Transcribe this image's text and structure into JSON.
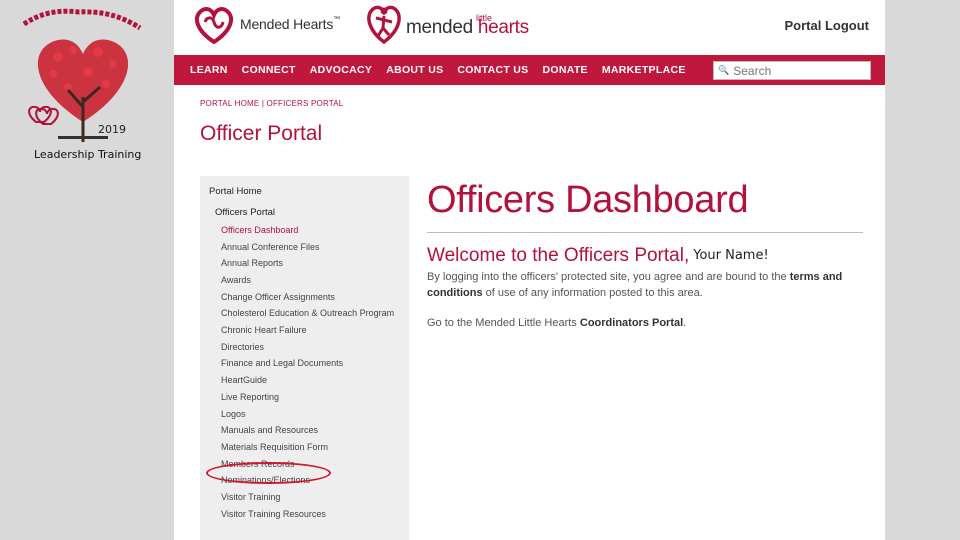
{
  "slide": {
    "year": "2019",
    "training_label": "Leadership Training"
  },
  "header": {
    "brand1": "Mended Hearts",
    "brand1_tm": "™",
    "brand2_small": "little",
    "brand2_a": "mended ",
    "brand2_b": "hearts",
    "logout": "Portal Logout"
  },
  "nav": {
    "items": [
      "LEARN",
      "CONNECT",
      "ADVOCACY",
      "ABOUT US",
      "CONTACT US",
      "DONATE",
      "MARKETPLACE"
    ],
    "search_placeholder": "Search"
  },
  "breadcrumb": "PORTAL HOME | OFFICERS PORTAL",
  "page_title": "Officer Portal",
  "sidebar": {
    "home": "Portal Home",
    "section": "Officers Portal",
    "items": [
      "Officers Dashboard",
      "Annual Conference Files",
      "Annual Reports",
      "Awards",
      "Change Officer Assignments",
      "Cholesterol Education & Outreach Program",
      "Chronic Heart Failure",
      "Directories",
      "Finance and Legal Documents",
      "HeartGuide",
      "Live Reporting",
      "Logos",
      "Manuals and Resources",
      "Materials Requisition Form",
      "Members Records",
      "Nominations/Elections",
      "Visitor Training",
      "Visitor Training Resources"
    ]
  },
  "main": {
    "title": "Officers Dashboard",
    "welcome": "Welcome to the Officers Portal,",
    "name": "Your Name!",
    "p1_a": "By logging into the officers' protected site, you agree and are bound to the ",
    "p1_b": "terms and conditions",
    "p1_c": " of use of any information posted to this area.",
    "p2_a": "Go to the Mended Little Hearts ",
    "p2_b": "Coordinators Portal",
    "p2_c": "."
  },
  "colors": {
    "brand": "#c0173d",
    "accent_text": "#b2123b",
    "highlight_circle": "#d1162e"
  }
}
